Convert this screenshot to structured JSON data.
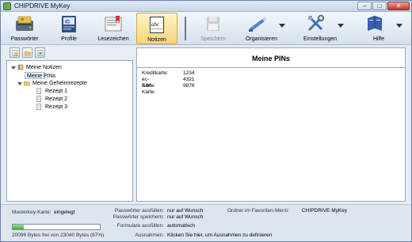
{
  "window": {
    "title": "CHIPDRIVE MyKey",
    "controls": {
      "minimize": "–",
      "maximize": "□",
      "close": "✕"
    }
  },
  "toolbar": {
    "items": [
      {
        "label": "Passwörter",
        "icon": "card-reader-icon"
      },
      {
        "label": "Profile",
        "icon": "id-card-icon"
      },
      {
        "label": "Lesezeichen",
        "icon": "bookmarks-icon"
      },
      {
        "label": "Notizen",
        "icon": "notepad-icon",
        "active": true
      },
      {
        "label": "Speichern",
        "icon": "save-icon",
        "disabled": true
      },
      {
        "label": "Organisieren",
        "icon": "organize-icon",
        "dropdown": true
      },
      {
        "label": "Einstellungen",
        "icon": "tools-icon",
        "dropdown": true
      },
      {
        "label": "Hilfe",
        "icon": "help-icon",
        "dropdown": true
      }
    ]
  },
  "tree": {
    "root": {
      "label": "Meine Notizen"
    },
    "selected": {
      "label": "Meine PINs"
    },
    "folder": {
      "label": "Meine Geheimrezepte"
    },
    "children": [
      {
        "label": "Rezept 1"
      },
      {
        "label": "Rezept 2"
      },
      {
        "label": "Rezept 3"
      }
    ]
  },
  "document": {
    "title": "Meine PINs",
    "rows": [
      {
        "key": "Kreditkarte:",
        "value": "1234"
      },
      {
        "key": "ec-Karte:",
        "value": "4321"
      },
      {
        "key": "SIM-Karte:",
        "value": "9876"
      }
    ]
  },
  "status": {
    "masterkey_label": "Masterkey-Karte:",
    "masterkey_value": "eingelegt",
    "pw_fill_label": "Passwörter ausfüllen:",
    "pw_fill_value": "nur auf Wunsch",
    "pw_save_label": "Passwörter speichern:",
    "pw_save_value": "nur auf Wunsch",
    "forms_label": "Formulare ausfüllen:",
    "forms_value": "automatisch",
    "exceptions_label": "Ausnahmen:",
    "exceptions_value": "Klicken Sie hier, um Ausnahmen zu definieren",
    "favorites_label": "Ordner im Favoriten-Menü:",
    "favorites_value": "CHIPDRIVE MyKey",
    "storage_text": "20096 Bytes frei von 23040 Bytes (87%)",
    "storage_used_fraction": 0.13
  },
  "colors": {
    "accent": "#f5d57a",
    "progress": "#3eae2a",
    "title_bg": "#c7d6ea"
  }
}
